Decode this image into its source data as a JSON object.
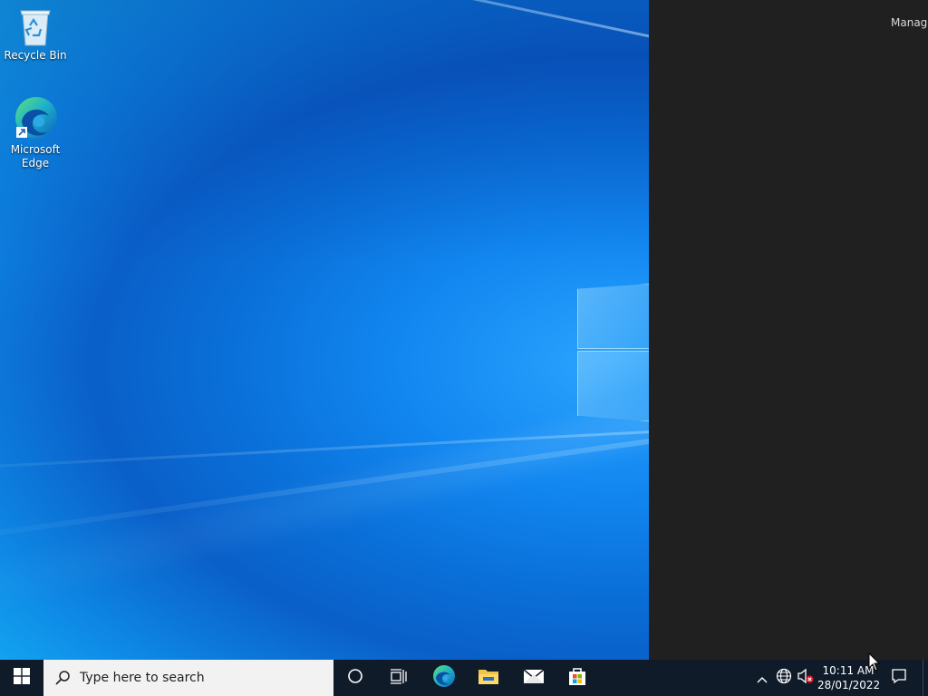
{
  "desktop": {
    "icons": [
      {
        "label": "Recycle Bin",
        "icon": "recycle-bin-icon"
      },
      {
        "label": "Microsoft\nEdge",
        "icon": "edge-icon"
      }
    ]
  },
  "side_panel": {
    "header_text": "Manage"
  },
  "taskbar": {
    "start_icon": "windows-start-icon",
    "search_placeholder": "Type here to search",
    "pinned": [
      "cortana-icon",
      "task-view-icon",
      "edge-icon",
      "file-explorer-icon",
      "mail-icon",
      "store-icon"
    ],
    "tray": {
      "time": "10:11 AM",
      "date": "28/01/2022"
    }
  },
  "colors": {
    "taskbar_bg": "#101b2a",
    "panel_bg": "#202020",
    "desktop_blue": "#0b74d8"
  }
}
